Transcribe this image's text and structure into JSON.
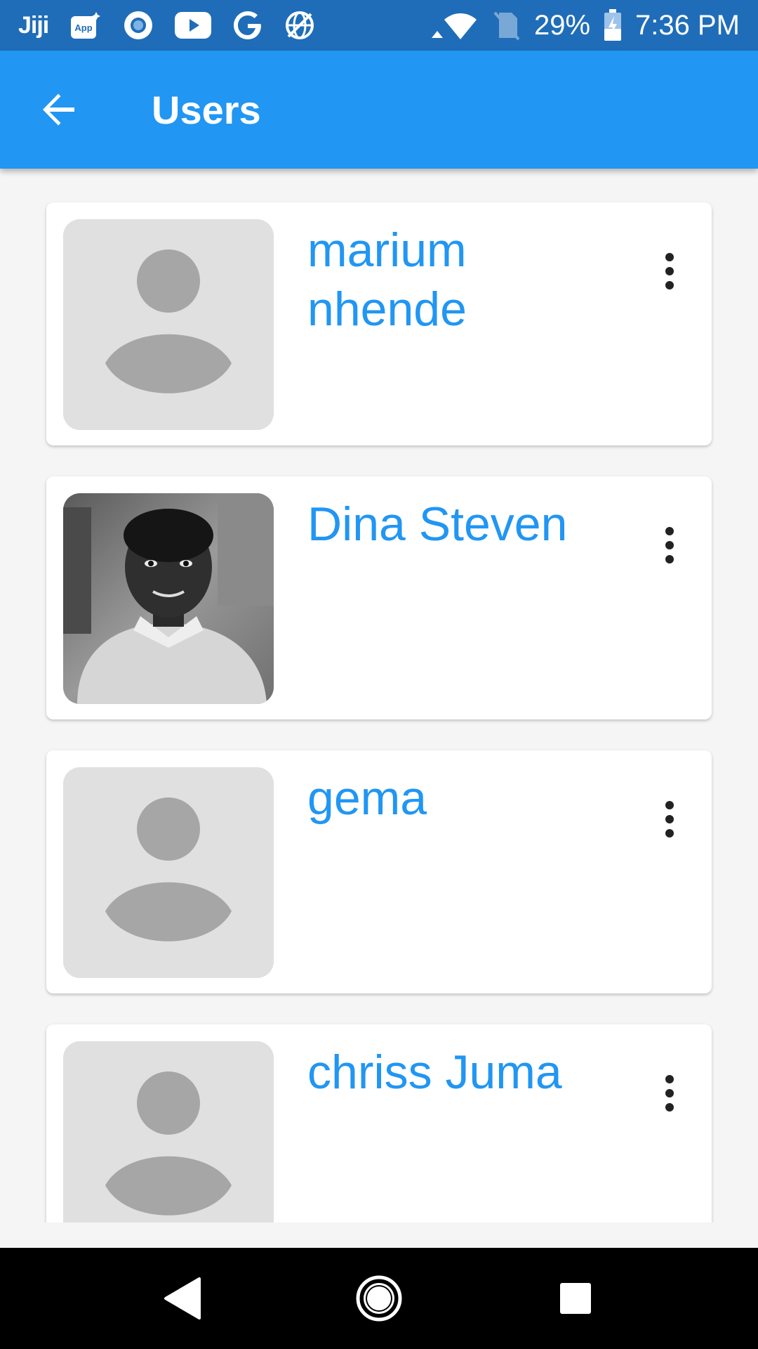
{
  "status_bar": {
    "left_icons": [
      "jiji-app-icon",
      "app-store-icon",
      "browser-circle-icon",
      "youtube-icon",
      "google-icon",
      "network-globe-icon"
    ],
    "jiji_label": "Jiji",
    "app_label": "App",
    "battery_percent": "29%",
    "time": "7:36 PM"
  },
  "app_bar": {
    "title": "Users",
    "back_icon": "arrow-back-icon"
  },
  "users": [
    {
      "name": "marium nhende",
      "avatar": "placeholder"
    },
    {
      "name": "Dina Steven",
      "avatar": "photo"
    },
    {
      "name": "gema",
      "avatar": "placeholder"
    },
    {
      "name": "chriss Juma",
      "avatar": "placeholder"
    }
  ],
  "nav_bar": {
    "icons": [
      "nav-back-icon",
      "nav-home-icon",
      "nav-recents-icon"
    ]
  },
  "colors": {
    "primary": "#2196f3",
    "status_bar": "#1f6db8",
    "background": "#f5f5f5",
    "name_text": "#2196f3"
  }
}
